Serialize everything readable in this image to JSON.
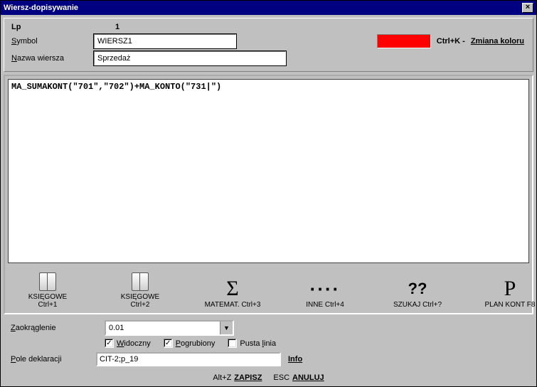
{
  "title": "Wiersz-dopisywanie",
  "fields": {
    "lp_label": "Lp",
    "lp_value": "1",
    "symbol_label": "Symbol",
    "symbol_value": "WIERSZ1",
    "name_label": "Nazwa wiersza",
    "name_value": "Sprzedaż",
    "ctrlk_label": "Ctrl+K -",
    "color_link": "Zmiana koloru",
    "color_value": "#ff0000"
  },
  "formula": "MA_SUMAKONT(\"701\",\"702\")+MA_KONTO(\"731|\")",
  "toolbar": [
    {
      "label": "KSIĘGOWE Ctrl+1",
      "icon": "book"
    },
    {
      "label": "KSIĘGOWE Ctrl+2",
      "icon": "book"
    },
    {
      "label": "MATEMAT. Ctrl+3",
      "icon": "Σ"
    },
    {
      "label": "INNE Ctrl+4",
      "icon": "····"
    },
    {
      "label": "SZUKAJ Ctrl+?",
      "icon": "??"
    },
    {
      "label": "PLAN KONT F8",
      "icon": "P"
    }
  ],
  "rounding": {
    "label": "Zaokrąglenie",
    "value": "0.01"
  },
  "checks": {
    "visible": {
      "label": "Widoczny",
      "checked": true
    },
    "bold": {
      "label": "Pogrubiony",
      "checked": true
    },
    "empty": {
      "label": "Pusta linia",
      "checked": false
    }
  },
  "declaration": {
    "label": "Pole deklaracji",
    "value": "CIT-2;p_19",
    "info": "Info"
  },
  "actions": {
    "save_prefix": "Alt+Z",
    "save": "ZAPISZ",
    "cancel_prefix": "ESC",
    "cancel": "ANULUJ"
  }
}
